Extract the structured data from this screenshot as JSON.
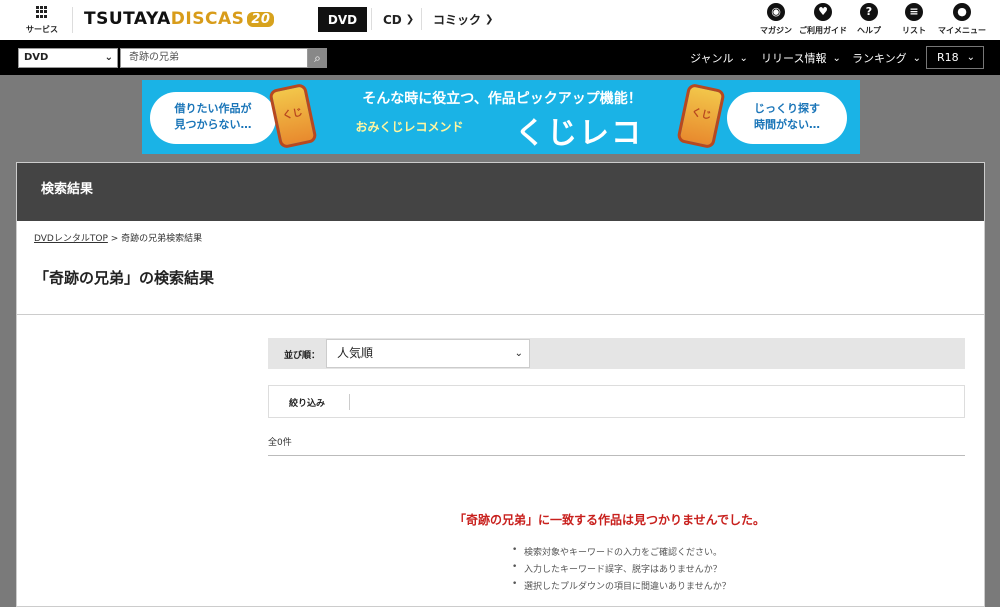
{
  "header": {
    "service_label": "サービス",
    "logo": {
      "part1": "TSUTAYA",
      "part2": "DISCAS",
      "badge": "20"
    },
    "tabs": [
      {
        "label": "DVD",
        "active": true
      },
      {
        "label": "CD"
      },
      {
        "label": "コミック"
      }
    ],
    "right_icons": [
      {
        "label": "マガジン",
        "icon": "magazine-icon"
      },
      {
        "label": "ご利用ガイド",
        "icon": "guide-icon"
      },
      {
        "label": "ヘルプ",
        "icon": "help-icon"
      },
      {
        "label": "リスト",
        "icon": "list-icon"
      },
      {
        "label": "マイメニュー",
        "icon": "user-icon"
      }
    ]
  },
  "search": {
    "category": "DVD",
    "query": "奇跡の兄弟",
    "menu": [
      {
        "label": "ジャンル"
      },
      {
        "label": "リリース情報"
      },
      {
        "label": "ランキング"
      }
    ],
    "r18_label": "R18"
  },
  "banner": {
    "left_line1": "借りたい作品が",
    "left_line2": "見つからない…",
    "headline": "そんな時に役立つ、作品ピックアップ機能！",
    "sub": "おみくじレコメンド",
    "brand": "くじレコ",
    "right_line1": "じっくり探す",
    "right_line2": "時間がない…",
    "kuji_label": "くじ"
  },
  "content": {
    "section_title": "検索結果",
    "breadcrumb": {
      "home": "DVDレンタルTOP",
      "sep": " > ",
      "current": "奇跡の兄弟検索結果"
    },
    "page_title": "「奇跡の兄弟」の検索結果",
    "sort_label": "並び順：",
    "sort_value": "人気順",
    "filter_label": "絞り込み",
    "count": "全0件",
    "no_results": "「奇跡の兄弟」に一致する作品は見つかりませんでした。",
    "tips": [
      "検索対象やキーワードの入力をご確認ください。",
      "入力したキーワード誤字、脱字はありませんか？",
      "選択したプルダウンの項目に間違いありませんか？"
    ]
  },
  "colors": {
    "header_bg": "#000000",
    "section_head_bg": "#444444",
    "banner_bg": "#1ab3e6",
    "no_result_text": "#c8201d"
  }
}
